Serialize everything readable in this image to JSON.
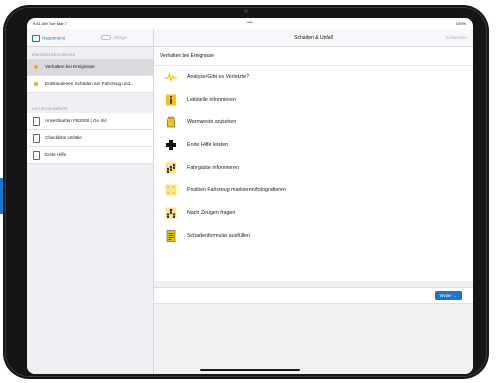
{
  "status_bar": {
    "time": "9:41 AM  Tue Mar 7",
    "dots": "•••",
    "battery": "100%"
  },
  "sidebar": {
    "back_label": "Hauptmenü",
    "middle_label": "Ablage",
    "section1_header": "EREIGNISGESCHEHEN",
    "section1_items": [
      {
        "label": "Verhalten bei Ereignisse"
      },
      {
        "label": "Entstandenen Schäden am Fahrzeug und..."
      }
    ],
    "section2_header": "HILFSDOKUMENTE",
    "section2_items": [
      {
        "label": "Ansetzkarten FB2000 | Ge 4/4"
      },
      {
        "label": "Checkliste Unfälle"
      },
      {
        "label": "Erste Hilfe"
      }
    ]
  },
  "main": {
    "nav_title": "Schaden & Unfall",
    "nav_right": "Schliessen",
    "content_title": "Verhalten bei Ereignisse",
    "rows": [
      {
        "label": "Analyse/Gibt es Verletzte?"
      },
      {
        "label": "Leitstelle informieren"
      },
      {
        "label": "Warnweste anziehen"
      },
      {
        "label": "Erste Hilfe leisten"
      },
      {
        "label": "Fahrgäste informieren"
      },
      {
        "label": "Position Fahrzeug markieren/fotografieren"
      },
      {
        "label": "Nach Zeugen fragen"
      },
      {
        "label": "Schadenformular ausfüllen"
      }
    ],
    "next_button": "Weiter  →"
  },
  "colors": {
    "accent": "#1f74c8",
    "icon_yellow": "#f0c419",
    "status_dot": "#f5a623"
  }
}
